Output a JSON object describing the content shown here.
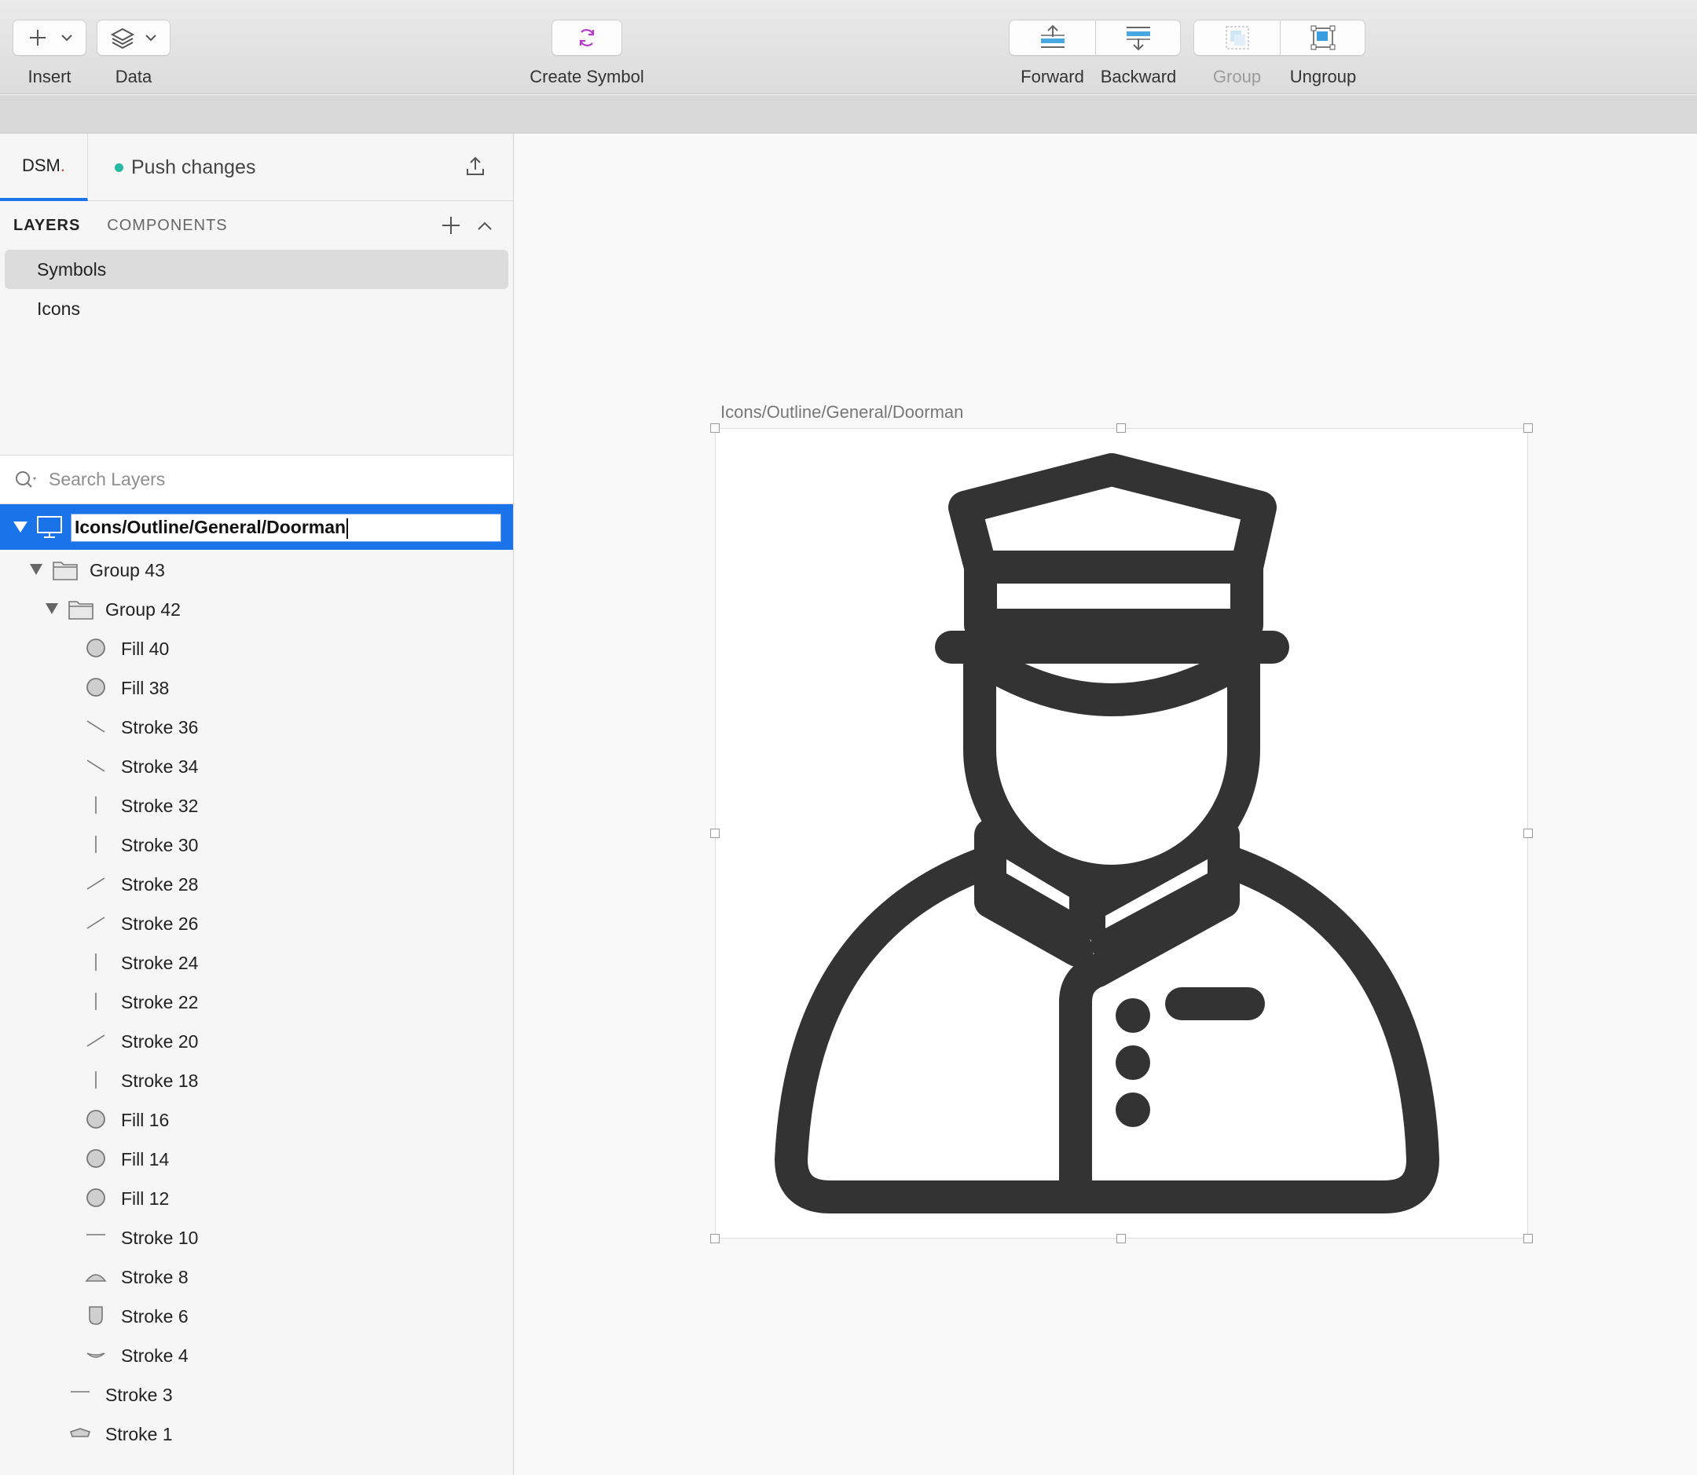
{
  "toolbar": {
    "insert_label": "Insert",
    "data_label": "Data",
    "create_symbol_label": "Create Symbol",
    "forward_label": "Forward",
    "backward_label": "Backward",
    "group_label": "Group",
    "ungroup_label": "Ungroup"
  },
  "dsm": {
    "logo_text": "DSM",
    "logo_dot": ".",
    "push_label": "Push changes"
  },
  "tabs": {
    "layers": "LAYERS",
    "components": "COMPONENTS"
  },
  "pages": [
    {
      "label": "Symbols",
      "selected": true
    },
    {
      "label": "Icons",
      "selected": false
    }
  ],
  "search": {
    "placeholder": "Search Layers"
  },
  "layers": {
    "root_name": "Icons/Outline/General/Doorman",
    "items": [
      {
        "name": "Group 43",
        "icon": "folder-icon"
      },
      {
        "name": "Group 42",
        "icon": "folder-icon"
      },
      {
        "name": "Fill 40",
        "icon": "oval-icon"
      },
      {
        "name": "Fill 38",
        "icon": "oval-icon"
      },
      {
        "name": "Stroke 36",
        "icon": "line-down-icon"
      },
      {
        "name": "Stroke 34",
        "icon": "line-down-icon"
      },
      {
        "name": "Stroke 32",
        "icon": "line-vertical-icon"
      },
      {
        "name": "Stroke 30",
        "icon": "line-vertical-icon"
      },
      {
        "name": "Stroke 28",
        "icon": "line-up-icon"
      },
      {
        "name": "Stroke 26",
        "icon": "line-up-icon"
      },
      {
        "name": "Stroke 24",
        "icon": "line-vertical-icon"
      },
      {
        "name": "Stroke 22",
        "icon": "line-vertical-icon"
      },
      {
        "name": "Stroke 20",
        "icon": "line-up-icon"
      },
      {
        "name": "Stroke 18",
        "icon": "line-vertical-icon"
      },
      {
        "name": "Fill 16",
        "icon": "oval-icon"
      },
      {
        "name": "Fill 14",
        "icon": "oval-icon"
      },
      {
        "name": "Fill 12",
        "icon": "oval-icon"
      },
      {
        "name": "Stroke 10",
        "icon": "line-horizontal-icon"
      },
      {
        "name": "Stroke 8",
        "icon": "dome-shape-icon"
      },
      {
        "name": "Stroke 6",
        "icon": "shield-shape-icon"
      },
      {
        "name": "Stroke 4",
        "icon": "arc-shape-icon"
      },
      {
        "name": "Stroke 3",
        "icon": "line-horizontal-icon"
      },
      {
        "name": "Stroke 1",
        "icon": "cap-shape-icon"
      }
    ]
  },
  "canvas": {
    "artboard_title": "Icons/Outline/General/Doorman",
    "icon_name": "doorman-icon",
    "icon_color": "#333333"
  },
  "colors": {
    "selection_blue": "#1a73e8",
    "push_dot": "#26b8a0",
    "symbol_purple": "#b23cc8"
  }
}
